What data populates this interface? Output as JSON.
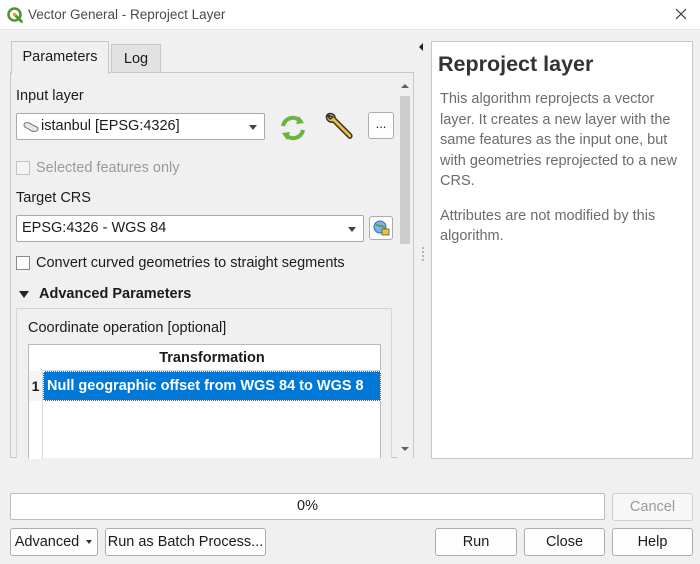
{
  "window": {
    "title": "Vector General - Reproject Layer"
  },
  "tabs": {
    "parameters": "Parameters",
    "log": "Log"
  },
  "input_layer": {
    "label": "Input layer",
    "value": "istanbul [EPSG:4326]",
    "more_label": "..."
  },
  "selected_features": {
    "label": "Selected features only",
    "checked": false,
    "enabled": false
  },
  "target_crs": {
    "label": "Target CRS",
    "value": "EPSG:4326 - WGS 84"
  },
  "convert_curved": {
    "label": "Convert curved geometries to straight segments",
    "checked": false
  },
  "advanced_section": {
    "label": "Advanced Parameters",
    "expanded": true
  },
  "coordinate_operation": {
    "label": "Coordinate operation [optional]",
    "table_header": "Transformation",
    "rows": [
      {
        "index": "1",
        "value": "Null geographic offset from WGS 84 to WGS 8"
      }
    ]
  },
  "help": {
    "title": "Reproject layer",
    "paragraphs": [
      "This algorithm reprojects a vector layer. It creates a new layer with the same features as the input one, but with geometries reprojected to a new CRS.",
      "Attributes are not modified by this algorithm."
    ]
  },
  "progress": {
    "text": "0%",
    "value": 0
  },
  "buttons": {
    "cancel": "Cancel",
    "advanced": "Advanced",
    "batch": "Run as Batch Process...",
    "run": "Run",
    "close": "Close",
    "help": "Help"
  },
  "colors": {
    "selection": "#0078d7",
    "qgis_green": "#4c9a2a",
    "help_title": "#333333"
  },
  "icons": [
    "qgis-logo-icon",
    "window-close-icon",
    "vector-layer-icon",
    "iterate-icon",
    "wrench-icon",
    "crs-select-icon",
    "collapse-arrow-icon",
    "splitter-arrow-icon"
  ]
}
